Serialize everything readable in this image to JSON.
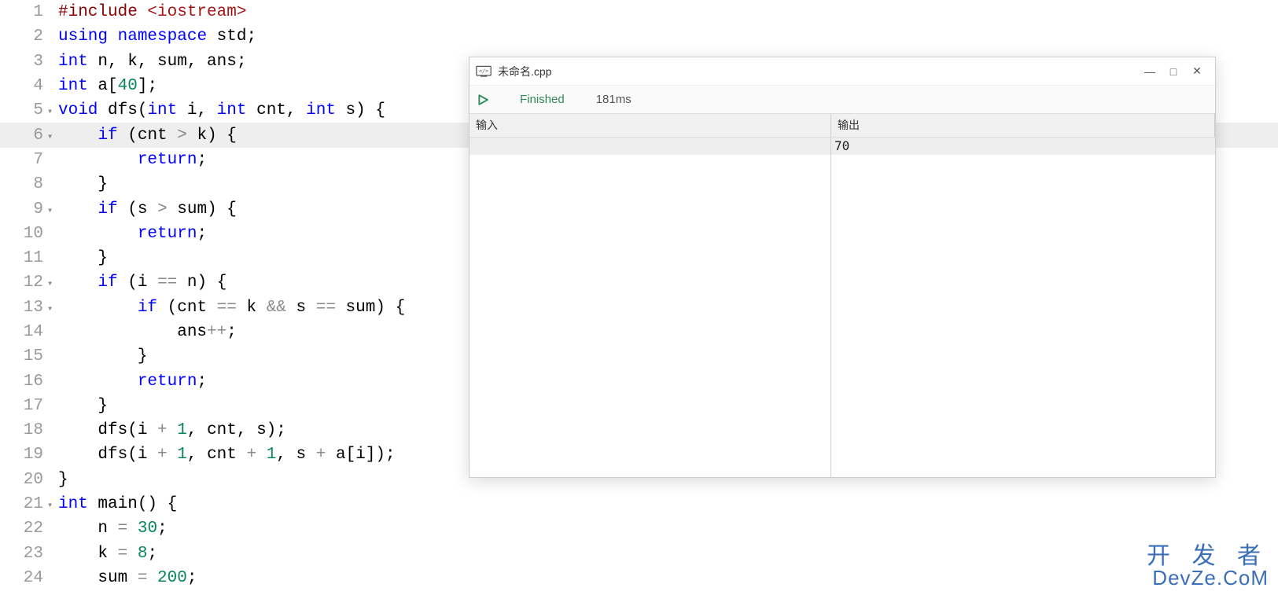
{
  "editor": {
    "highlight_line": 6,
    "lines": [
      {
        "n": 1,
        "fold": "",
        "tokens": [
          {
            "t": "#include ",
            "c": "pp"
          },
          {
            "t": "<iostream>",
            "c": "inc"
          }
        ]
      },
      {
        "n": 2,
        "fold": "",
        "tokens": [
          {
            "t": "using",
            "c": "kw"
          },
          {
            "t": " ",
            "c": "id"
          },
          {
            "t": "namespace",
            "c": "kw"
          },
          {
            "t": " std;",
            "c": "id"
          }
        ]
      },
      {
        "n": 3,
        "fold": "",
        "tokens": [
          {
            "t": "int",
            "c": "kw"
          },
          {
            "t": " n, k, sum, ans;",
            "c": "id"
          }
        ]
      },
      {
        "n": 4,
        "fold": "",
        "tokens": [
          {
            "t": "int",
            "c": "kw"
          },
          {
            "t": " a[",
            "c": "id"
          },
          {
            "t": "40",
            "c": "num"
          },
          {
            "t": "];",
            "c": "id"
          }
        ]
      },
      {
        "n": 5,
        "fold": "▾",
        "tokens": [
          {
            "t": "void",
            "c": "kw"
          },
          {
            "t": " dfs(",
            "c": "id"
          },
          {
            "t": "int",
            "c": "kw"
          },
          {
            "t": " i, ",
            "c": "id"
          },
          {
            "t": "int",
            "c": "kw"
          },
          {
            "t": " cnt, ",
            "c": "id"
          },
          {
            "t": "int",
            "c": "kw"
          },
          {
            "t": " s) {",
            "c": "id"
          }
        ]
      },
      {
        "n": 6,
        "fold": "▾",
        "tokens": [
          {
            "t": "    ",
            "c": "id"
          },
          {
            "t": "if",
            "c": "kw"
          },
          {
            "t": " (cnt ",
            "c": "id"
          },
          {
            "t": ">",
            "c": "op"
          },
          {
            "t": " k) {",
            "c": "id"
          }
        ]
      },
      {
        "n": 7,
        "fold": "",
        "tokens": [
          {
            "t": "        ",
            "c": "id"
          },
          {
            "t": "return",
            "c": "kw"
          },
          {
            "t": ";",
            "c": "id"
          }
        ]
      },
      {
        "n": 8,
        "fold": "",
        "tokens": [
          {
            "t": "    }",
            "c": "id"
          }
        ]
      },
      {
        "n": 9,
        "fold": "▾",
        "tokens": [
          {
            "t": "    ",
            "c": "id"
          },
          {
            "t": "if",
            "c": "kw"
          },
          {
            "t": " (s ",
            "c": "id"
          },
          {
            "t": ">",
            "c": "op"
          },
          {
            "t": " sum) {",
            "c": "id"
          }
        ]
      },
      {
        "n": 10,
        "fold": "",
        "tokens": [
          {
            "t": "        ",
            "c": "id"
          },
          {
            "t": "return",
            "c": "kw"
          },
          {
            "t": ";",
            "c": "id"
          }
        ]
      },
      {
        "n": 11,
        "fold": "",
        "tokens": [
          {
            "t": "    }",
            "c": "id"
          }
        ]
      },
      {
        "n": 12,
        "fold": "▾",
        "tokens": [
          {
            "t": "    ",
            "c": "id"
          },
          {
            "t": "if",
            "c": "kw"
          },
          {
            "t": " (i ",
            "c": "id"
          },
          {
            "t": "==",
            "c": "op"
          },
          {
            "t": " n) {",
            "c": "id"
          }
        ]
      },
      {
        "n": 13,
        "fold": "▾",
        "tokens": [
          {
            "t": "        ",
            "c": "id"
          },
          {
            "t": "if",
            "c": "kw"
          },
          {
            "t": " (cnt ",
            "c": "id"
          },
          {
            "t": "==",
            "c": "op"
          },
          {
            "t": " k ",
            "c": "id"
          },
          {
            "t": "&&",
            "c": "op"
          },
          {
            "t": " s ",
            "c": "id"
          },
          {
            "t": "==",
            "c": "op"
          },
          {
            "t": " sum) {",
            "c": "id"
          }
        ]
      },
      {
        "n": 14,
        "fold": "",
        "tokens": [
          {
            "t": "            ans",
            "c": "id"
          },
          {
            "t": "++",
            "c": "op"
          },
          {
            "t": ";",
            "c": "id"
          }
        ]
      },
      {
        "n": 15,
        "fold": "",
        "tokens": [
          {
            "t": "        }",
            "c": "id"
          }
        ]
      },
      {
        "n": 16,
        "fold": "",
        "tokens": [
          {
            "t": "        ",
            "c": "id"
          },
          {
            "t": "return",
            "c": "kw"
          },
          {
            "t": ";",
            "c": "id"
          }
        ]
      },
      {
        "n": 17,
        "fold": "",
        "tokens": [
          {
            "t": "    }",
            "c": "id"
          }
        ]
      },
      {
        "n": 18,
        "fold": "",
        "tokens": [
          {
            "t": "    dfs(i ",
            "c": "id"
          },
          {
            "t": "+",
            "c": "op"
          },
          {
            "t": " ",
            "c": "id"
          },
          {
            "t": "1",
            "c": "num"
          },
          {
            "t": ", cnt, s);",
            "c": "id"
          }
        ]
      },
      {
        "n": 19,
        "fold": "",
        "tokens": [
          {
            "t": "    dfs(i ",
            "c": "id"
          },
          {
            "t": "+",
            "c": "op"
          },
          {
            "t": " ",
            "c": "id"
          },
          {
            "t": "1",
            "c": "num"
          },
          {
            "t": ", cnt ",
            "c": "id"
          },
          {
            "t": "+",
            "c": "op"
          },
          {
            "t": " ",
            "c": "id"
          },
          {
            "t": "1",
            "c": "num"
          },
          {
            "t": ", s ",
            "c": "id"
          },
          {
            "t": "+",
            "c": "op"
          },
          {
            "t": " a[i]);",
            "c": "id"
          }
        ]
      },
      {
        "n": 20,
        "fold": "",
        "tokens": [
          {
            "t": "}",
            "c": "id"
          }
        ]
      },
      {
        "n": 21,
        "fold": "▾",
        "tokens": [
          {
            "t": "int",
            "c": "kw"
          },
          {
            "t": " main() {",
            "c": "id"
          }
        ]
      },
      {
        "n": 22,
        "fold": "",
        "tokens": [
          {
            "t": "    n ",
            "c": "id"
          },
          {
            "t": "=",
            "c": "op"
          },
          {
            "t": " ",
            "c": "id"
          },
          {
            "t": "30",
            "c": "num"
          },
          {
            "t": ";",
            "c": "id"
          }
        ]
      },
      {
        "n": 23,
        "fold": "",
        "tokens": [
          {
            "t": "    k ",
            "c": "id"
          },
          {
            "t": "=",
            "c": "op"
          },
          {
            "t": " ",
            "c": "id"
          },
          {
            "t": "8",
            "c": "num"
          },
          {
            "t": ";",
            "c": "id"
          }
        ]
      },
      {
        "n": 24,
        "fold": "",
        "tokens": [
          {
            "t": "    sum ",
            "c": "id"
          },
          {
            "t": "=",
            "c": "op"
          },
          {
            "t": " ",
            "c": "id"
          },
          {
            "t": "200",
            "c": "num"
          },
          {
            "t": ";",
            "c": "id"
          }
        ]
      }
    ]
  },
  "popup": {
    "title": "未命名.cpp",
    "status": "Finished",
    "time": "181ms",
    "headers": {
      "input": "输入",
      "output": "输出"
    },
    "input_text": "",
    "output_text": "70",
    "win": {
      "min": "—",
      "max": "□",
      "close": "✕"
    }
  },
  "watermark": {
    "cn": "开 发 者",
    "en": "DevZe.CoM"
  }
}
